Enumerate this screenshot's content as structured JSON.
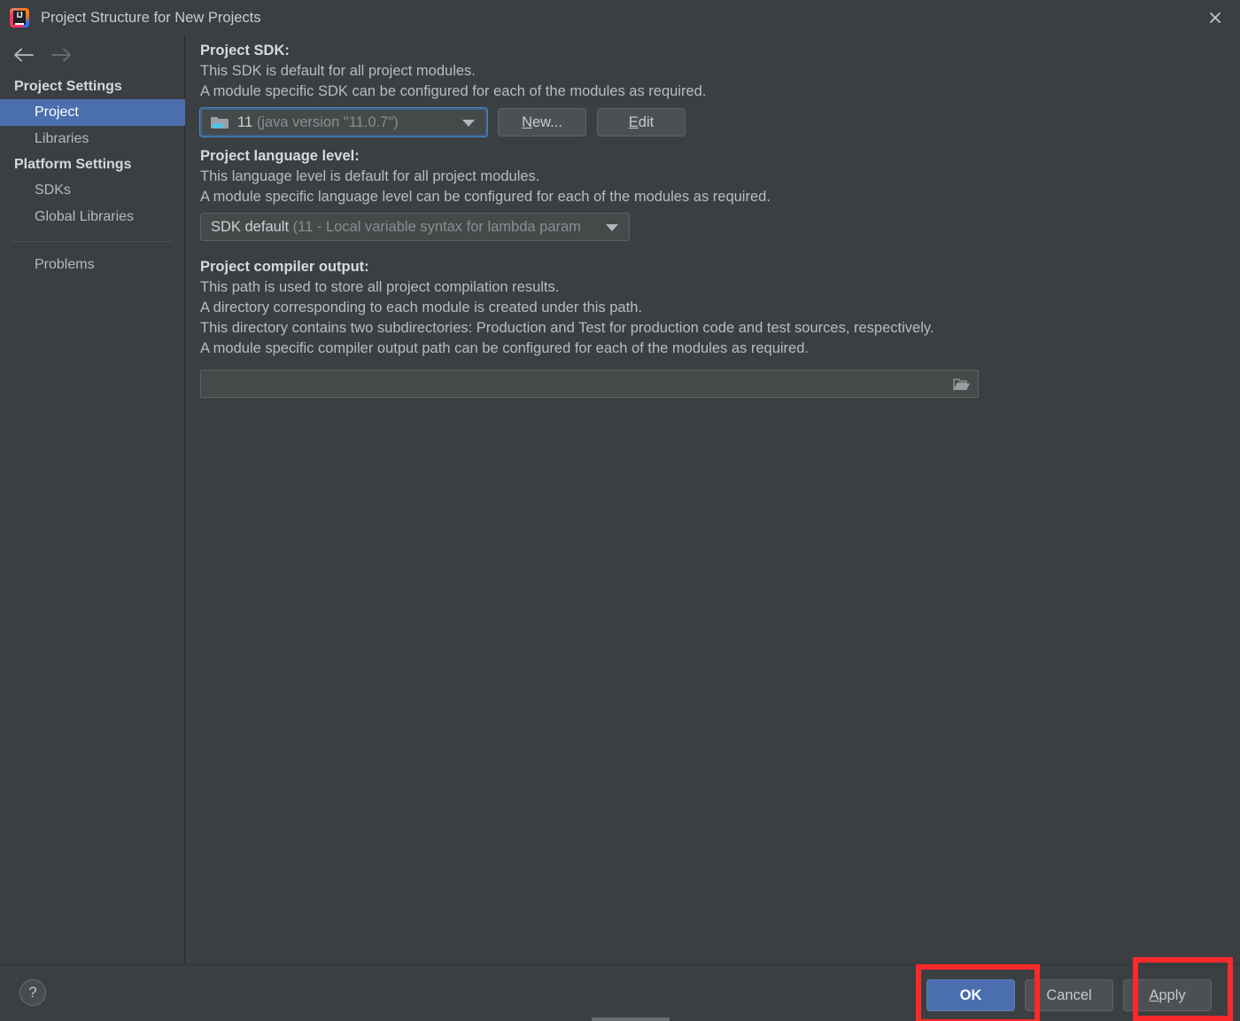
{
  "window": {
    "title": "Project Structure for New Projects",
    "logo_text": "IJ",
    "close_icon": "close-icon"
  },
  "nav": {
    "back_icon": "arrow-left-icon",
    "forward_icon": "arrow-right-icon"
  },
  "sidebar": {
    "groups": [
      {
        "label": "Project Settings",
        "items": [
          {
            "label": "Project",
            "selected": true
          },
          {
            "label": "Libraries",
            "selected": false
          }
        ]
      },
      {
        "label": "Platform Settings",
        "items": [
          {
            "label": "SDKs",
            "selected": false
          },
          {
            "label": "Global Libraries",
            "selected": false
          }
        ]
      }
    ],
    "extra_items": [
      {
        "label": "Problems",
        "selected": false
      }
    ]
  },
  "main": {
    "sdk": {
      "title": "Project SDK:",
      "desc_line1": "This SDK is default for all project modules.",
      "desc_line2": "A module specific SDK can be configured for each of the modules as required.",
      "value_primary": "11",
      "value_secondary": "(java version \"11.0.7\")",
      "icon": "java-sdk-folder-icon",
      "new_button": {
        "mnemonic": "N",
        "rest": "ew..."
      },
      "edit_button": {
        "mnemonic": "E",
        "rest": "dit"
      }
    },
    "language_level": {
      "title": "Project language level:",
      "desc_line1": "This language level is default for all project modules.",
      "desc_line2": "A module specific language level can be configured for each of the modules as required.",
      "value_primary": "SDK default",
      "value_secondary": "(11 - Local variable syntax for lambda param"
    },
    "compiler_output": {
      "title": "Project compiler output:",
      "desc_line1": "This path is used to store all project compilation results.",
      "desc_line2": "A directory corresponding to each module is created under this path.",
      "desc_line3": "This directory contains two subdirectories: Production and Test for production code and test sources, respectively.",
      "desc_line4": "A module specific compiler output path can be configured for each of the modules as required.",
      "value": "",
      "placeholder": "",
      "browse_icon": "folder-open-icon"
    }
  },
  "footer": {
    "help_label": "?",
    "help_icon": "question-mark-icon",
    "buttons": [
      {
        "label": "OK",
        "style": "default"
      },
      {
        "label": "Cancel",
        "style": "normal"
      },
      {
        "label": "Apply",
        "style": "normal",
        "mnemonic": "A",
        "rest": "pply"
      }
    ]
  },
  "annotations": {
    "color": "#fb2a2a",
    "boxes": [
      "ok-button",
      "apply-button"
    ]
  }
}
